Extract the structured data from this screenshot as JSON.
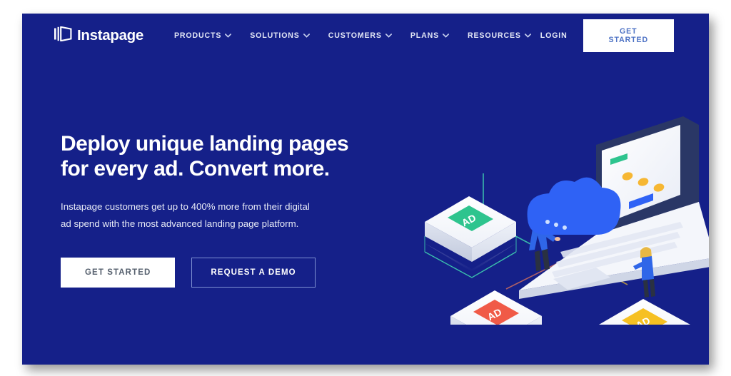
{
  "page": {
    "background_color": "#ffffff",
    "panel_color": "#152089"
  },
  "header": {
    "logo": {
      "icon": "instapage-book-icon",
      "text": "Instapage"
    },
    "nav_items": [
      {
        "label": "PRODUCTS",
        "icon": "chevron-down-icon"
      },
      {
        "label": "SOLUTIONS",
        "icon": "chevron-down-icon"
      },
      {
        "label": "CUSTOMERS",
        "icon": "chevron-down-icon"
      },
      {
        "label": "PLANS",
        "icon": "chevron-down-icon"
      },
      {
        "label": "RESOURCES",
        "icon": "chevron-down-icon"
      }
    ],
    "login_label": "LOGIN",
    "get_started_label": "GET STARTED",
    "get_started_color": "#ffffff",
    "get_started_text_color": "#4d72c4"
  },
  "hero": {
    "headline_line1": "Deploy unique landing pages",
    "headline_line2": "for every ad. Convert more.",
    "subtext": "Instapage customers get up to 400% more from their digital ad spend with the most advanced landing page platform.",
    "primary_cta": "GET STARTED",
    "secondary_cta": "REQUEST A DEMO"
  },
  "illustration": {
    "name": "isometric-ad-cloud-laptop-illustration",
    "cloud": {
      "name": "cloud-shape",
      "color": "#2f62f5"
    },
    "ad_tiles": [
      {
        "name": "ad-tile-green",
        "label": "AD",
        "color": "#2ec48e",
        "outline": "#3fd2b0"
      },
      {
        "name": "ad-tile-red",
        "label": "AD",
        "color": "#f05a47",
        "outline": "#c96a63"
      },
      {
        "name": "ad-tile-yellow",
        "label": "AD",
        "color": "#f6c022",
        "outline": "#b69a3c"
      }
    ],
    "laptop": {
      "name": "laptop-device",
      "screen_elements": [
        "green-pill",
        "orange-circle",
        "orange-circle",
        "orange-circle",
        "blue-button"
      ]
    },
    "people": [
      {
        "name": "person-standing-left"
      },
      {
        "name": "person-standing-right"
      }
    ]
  }
}
